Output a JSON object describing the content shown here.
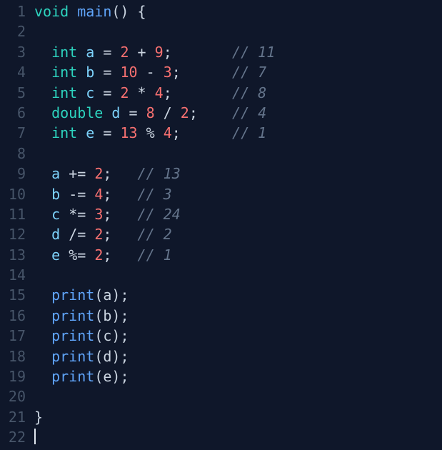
{
  "editor": {
    "language": "dart",
    "cursor_line": 22,
    "lines": [
      {
        "num": 1,
        "tokens": [
          [
            "kw",
            "void"
          ],
          [
            "sp",
            " "
          ],
          [
            "fn",
            "main"
          ],
          [
            "punc",
            "()"
          ],
          [
            "sp",
            " "
          ],
          [
            "punc",
            "{"
          ]
        ]
      },
      {
        "num": 2,
        "tokens": []
      },
      {
        "num": 3,
        "tokens": [
          [
            "sp",
            "  "
          ],
          [
            "kw",
            "int"
          ],
          [
            "sp",
            " "
          ],
          [
            "var-decl",
            "a"
          ],
          [
            "sp",
            " "
          ],
          [
            "op",
            "="
          ],
          [
            "sp",
            " "
          ],
          [
            "num",
            "2"
          ],
          [
            "sp",
            " "
          ],
          [
            "op",
            "+"
          ],
          [
            "sp",
            " "
          ],
          [
            "num",
            "9"
          ],
          [
            "punc",
            ";"
          ],
          [
            "sp",
            "       "
          ],
          [
            "cmt",
            "// 11"
          ]
        ]
      },
      {
        "num": 4,
        "tokens": [
          [
            "sp",
            "  "
          ],
          [
            "kw",
            "int"
          ],
          [
            "sp",
            " "
          ],
          [
            "var-decl",
            "b"
          ],
          [
            "sp",
            " "
          ],
          [
            "op",
            "="
          ],
          [
            "sp",
            " "
          ],
          [
            "num",
            "10"
          ],
          [
            "sp",
            " "
          ],
          [
            "op",
            "-"
          ],
          [
            "sp",
            " "
          ],
          [
            "num",
            "3"
          ],
          [
            "punc",
            ";"
          ],
          [
            "sp",
            "      "
          ],
          [
            "cmt",
            "// 7"
          ]
        ]
      },
      {
        "num": 5,
        "tokens": [
          [
            "sp",
            "  "
          ],
          [
            "kw",
            "int"
          ],
          [
            "sp",
            " "
          ],
          [
            "var-decl",
            "c"
          ],
          [
            "sp",
            " "
          ],
          [
            "op",
            "="
          ],
          [
            "sp",
            " "
          ],
          [
            "num",
            "2"
          ],
          [
            "sp",
            " "
          ],
          [
            "op",
            "*"
          ],
          [
            "sp",
            " "
          ],
          [
            "num",
            "4"
          ],
          [
            "punc",
            ";"
          ],
          [
            "sp",
            "       "
          ],
          [
            "cmt",
            "// 8"
          ]
        ]
      },
      {
        "num": 6,
        "tokens": [
          [
            "sp",
            "  "
          ],
          [
            "kw",
            "double"
          ],
          [
            "sp",
            " "
          ],
          [
            "var-decl",
            "d"
          ],
          [
            "sp",
            " "
          ],
          [
            "op",
            "="
          ],
          [
            "sp",
            " "
          ],
          [
            "num",
            "8"
          ],
          [
            "sp",
            " "
          ],
          [
            "op",
            "/"
          ],
          [
            "sp",
            " "
          ],
          [
            "num",
            "2"
          ],
          [
            "punc",
            ";"
          ],
          [
            "sp",
            "    "
          ],
          [
            "cmt",
            "// 4"
          ]
        ]
      },
      {
        "num": 7,
        "tokens": [
          [
            "sp",
            "  "
          ],
          [
            "kw",
            "int"
          ],
          [
            "sp",
            " "
          ],
          [
            "var-decl",
            "e"
          ],
          [
            "sp",
            " "
          ],
          [
            "op",
            "="
          ],
          [
            "sp",
            " "
          ],
          [
            "num",
            "13"
          ],
          [
            "sp",
            " "
          ],
          [
            "op",
            "%"
          ],
          [
            "sp",
            " "
          ],
          [
            "num",
            "4"
          ],
          [
            "punc",
            ";"
          ],
          [
            "sp",
            "      "
          ],
          [
            "cmt",
            "// 1"
          ]
        ]
      },
      {
        "num": 8,
        "tokens": []
      },
      {
        "num": 9,
        "tokens": [
          [
            "sp",
            "  "
          ],
          [
            "var-decl",
            "a"
          ],
          [
            "sp",
            " "
          ],
          [
            "op",
            "+="
          ],
          [
            "sp",
            " "
          ],
          [
            "num",
            "2"
          ],
          [
            "punc",
            ";"
          ],
          [
            "sp",
            "   "
          ],
          [
            "cmt",
            "// 13"
          ]
        ]
      },
      {
        "num": 10,
        "tokens": [
          [
            "sp",
            "  "
          ],
          [
            "var-decl",
            "b"
          ],
          [
            "sp",
            " "
          ],
          [
            "op",
            "-="
          ],
          [
            "sp",
            " "
          ],
          [
            "num",
            "4"
          ],
          [
            "punc",
            ";"
          ],
          [
            "sp",
            "   "
          ],
          [
            "cmt",
            "// 3"
          ]
        ]
      },
      {
        "num": 11,
        "tokens": [
          [
            "sp",
            "  "
          ],
          [
            "var-decl",
            "c"
          ],
          [
            "sp",
            " "
          ],
          [
            "op",
            "*="
          ],
          [
            "sp",
            " "
          ],
          [
            "num",
            "3"
          ],
          [
            "punc",
            ";"
          ],
          [
            "sp",
            "   "
          ],
          [
            "cmt",
            "// 24"
          ]
        ]
      },
      {
        "num": 12,
        "tokens": [
          [
            "sp",
            "  "
          ],
          [
            "var-decl",
            "d"
          ],
          [
            "sp",
            " "
          ],
          [
            "op",
            "/="
          ],
          [
            "sp",
            " "
          ],
          [
            "num",
            "2"
          ],
          [
            "punc",
            ";"
          ],
          [
            "sp",
            "   "
          ],
          [
            "cmt",
            "// 2"
          ]
        ]
      },
      {
        "num": 13,
        "tokens": [
          [
            "sp",
            "  "
          ],
          [
            "var-decl",
            "e"
          ],
          [
            "sp",
            " "
          ],
          [
            "op",
            "%="
          ],
          [
            "sp",
            " "
          ],
          [
            "num",
            "2"
          ],
          [
            "punc",
            ";"
          ],
          [
            "sp",
            "   "
          ],
          [
            "cmt",
            "// 1"
          ]
        ]
      },
      {
        "num": 14,
        "tokens": []
      },
      {
        "num": 15,
        "tokens": [
          [
            "sp",
            "  "
          ],
          [
            "fn",
            "print"
          ],
          [
            "punc",
            "("
          ],
          [
            "var",
            "a"
          ],
          [
            "punc",
            ");"
          ]
        ]
      },
      {
        "num": 16,
        "tokens": [
          [
            "sp",
            "  "
          ],
          [
            "fn",
            "print"
          ],
          [
            "punc",
            "("
          ],
          [
            "var",
            "b"
          ],
          [
            "punc",
            ");"
          ]
        ]
      },
      {
        "num": 17,
        "tokens": [
          [
            "sp",
            "  "
          ],
          [
            "fn",
            "print"
          ],
          [
            "punc",
            "("
          ],
          [
            "var",
            "c"
          ],
          [
            "punc",
            ");"
          ]
        ]
      },
      {
        "num": 18,
        "tokens": [
          [
            "sp",
            "  "
          ],
          [
            "fn",
            "print"
          ],
          [
            "punc",
            "("
          ],
          [
            "var",
            "d"
          ],
          [
            "punc",
            ");"
          ]
        ]
      },
      {
        "num": 19,
        "tokens": [
          [
            "sp",
            "  "
          ],
          [
            "fn",
            "print"
          ],
          [
            "punc",
            "("
          ],
          [
            "var",
            "e"
          ],
          [
            "punc",
            ");"
          ]
        ]
      },
      {
        "num": 20,
        "tokens": []
      },
      {
        "num": 21,
        "tokens": [
          [
            "punc",
            "}"
          ]
        ]
      },
      {
        "num": 22,
        "tokens": [],
        "cursor": true
      }
    ]
  }
}
